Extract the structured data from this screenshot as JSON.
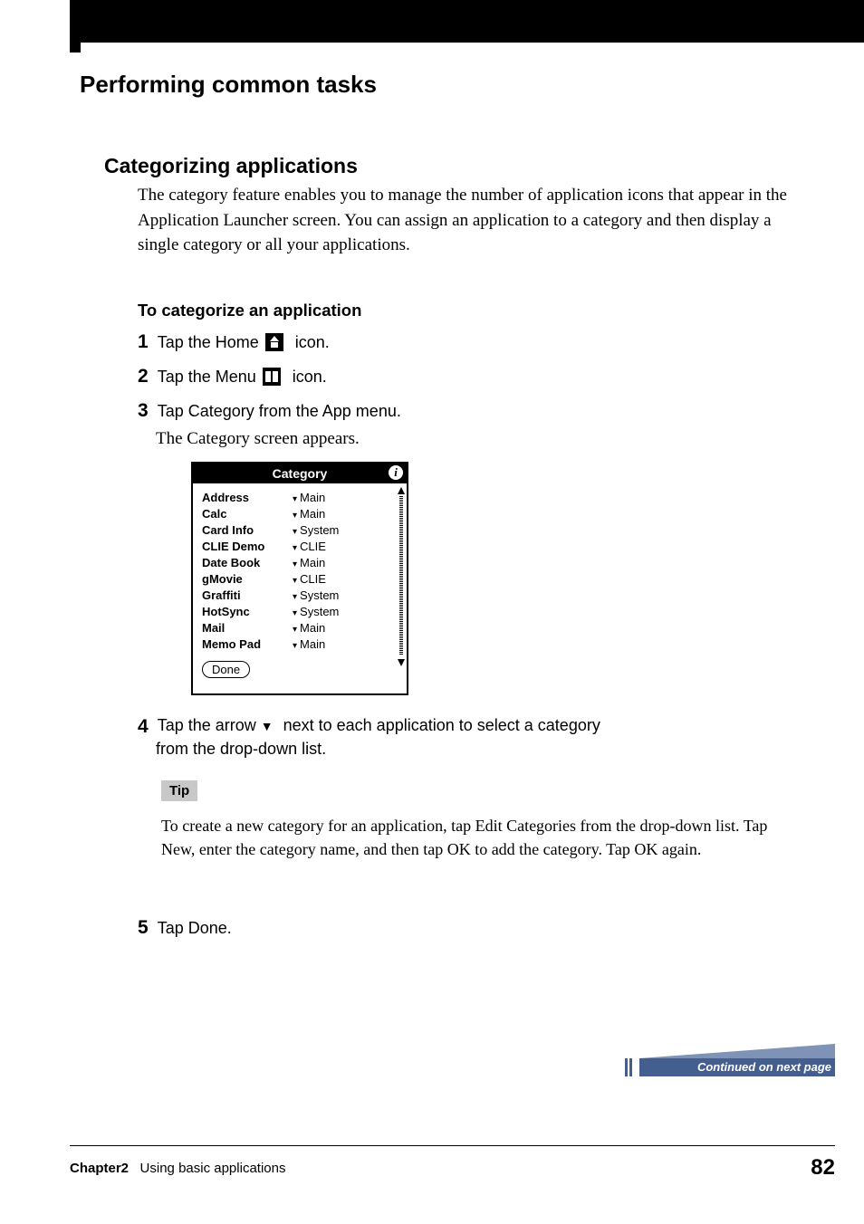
{
  "pageTitle": "Performing common tasks",
  "sectionHeading": "Categorizing applications",
  "sectionIntro": "The category feature enables you to manage the number of application icons that appear in the Application Launcher screen. You can assign an application to a category and then display a single category or all your applications.",
  "subsectionHeading": "To categorize an application",
  "steps": {
    "s1": {
      "num": "1",
      "pre": "Tap the Home ",
      "post": " icon."
    },
    "s2": {
      "num": "2",
      "pre": "Tap the Menu ",
      "post": " icon."
    },
    "s3": {
      "num": "3",
      "text": "Tap Category from the App menu.",
      "note": "The Category screen appears."
    },
    "s4": {
      "num": "4",
      "line1a": "Tap the arrow ",
      "line1b": " next to each application to select a category",
      "line2": "from the drop-down list."
    },
    "s5": {
      "num": "5",
      "text": "Tap Done."
    }
  },
  "categoryScreen": {
    "title": "Category",
    "infoIcon": "i",
    "rows": [
      {
        "app": "Address",
        "cat": "Main"
      },
      {
        "app": "Calc",
        "cat": "Main"
      },
      {
        "app": "Card Info",
        "cat": "System"
      },
      {
        "app": "CLIE Demo",
        "cat": "CLIE"
      },
      {
        "app": "Date Book",
        "cat": "Main"
      },
      {
        "app": "gMovie",
        "cat": "CLIE"
      },
      {
        "app": "Graffiti",
        "cat": "System"
      },
      {
        "app": "HotSync",
        "cat": "System"
      },
      {
        "app": "Mail",
        "cat": "Main"
      },
      {
        "app": "Memo Pad",
        "cat": "Main"
      }
    ],
    "doneLabel": "Done"
  },
  "tip": {
    "label": "Tip",
    "text": "To create a new category for an application, tap Edit Categories from the drop-down list. Tap New, enter the category name, and then tap OK to add the category. Tap OK again."
  },
  "continuedText": "Continued on next page",
  "footer": {
    "chapter": "Chapter2",
    "chapterTitle": "Using basic applications",
    "pageNum": "82"
  }
}
